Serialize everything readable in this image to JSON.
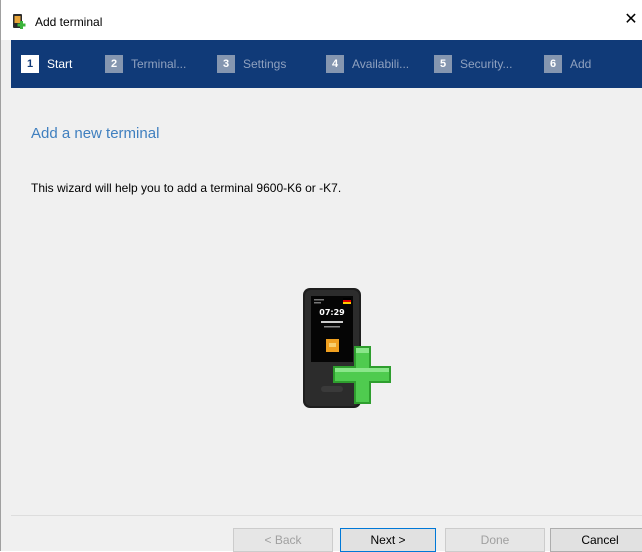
{
  "window": {
    "title": "Add terminal",
    "close_glyph": "✕"
  },
  "steps": [
    {
      "num": "1",
      "label": "Start",
      "active": true
    },
    {
      "num": "2",
      "label": "Terminal...",
      "active": false
    },
    {
      "num": "3",
      "label": "Settings",
      "active": false
    },
    {
      "num": "4",
      "label": "Availabili...",
      "active": false
    },
    {
      "num": "5",
      "label": "Security...",
      "active": false
    },
    {
      "num": "6",
      "label": "Add",
      "active": false
    }
  ],
  "content": {
    "heading": "Add a new terminal",
    "description": "This wizard will help you to add a terminal 9600-K6 or -K7.",
    "illustration": {
      "icon": "terminal-add-icon",
      "screen_time": "07:29"
    }
  },
  "footer": {
    "back_label": "< Back",
    "next_label": "Next >",
    "done_label": "Done",
    "cancel_label": "Cancel"
  },
  "colors": {
    "stepbar_bg": "#103a78",
    "heading": "#3f7fbf",
    "plus_green": "#3cb43c"
  }
}
